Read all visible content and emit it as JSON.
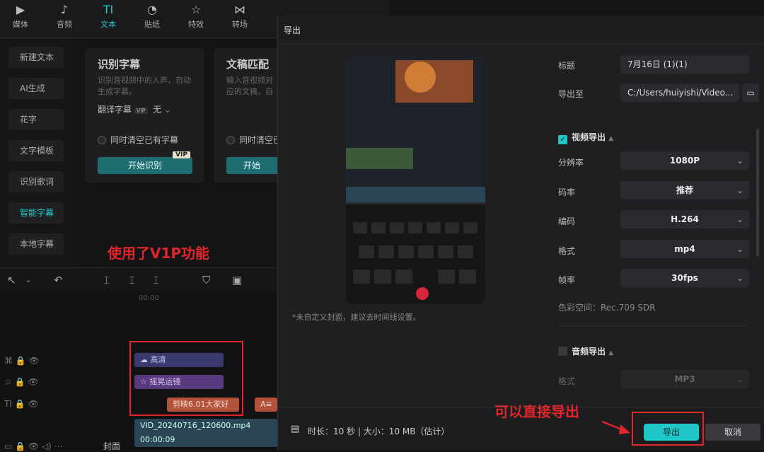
{
  "tabs": [
    {
      "label": "媒体",
      "icon": "media-icon"
    },
    {
      "label": "音频",
      "icon": "audio-icon"
    },
    {
      "label": "文本",
      "icon": "text-icon"
    },
    {
      "label": "贴纸",
      "icon": "sticker-icon"
    },
    {
      "label": "特效",
      "icon": "effects-icon"
    },
    {
      "label": "转场",
      "icon": "transition-icon"
    }
  ],
  "sidebar": {
    "items": [
      "新建文本",
      "AI生成",
      "花字",
      "文字模板",
      "识别歌词",
      "智能字幕",
      "本地字幕"
    ]
  },
  "cards": {
    "c1": {
      "title": "识别字幕",
      "desc": "识别音视频中的人声，自动生成字幕。",
      "translate_label": "翻译字幕",
      "translate_value": "无",
      "clear_label": "同时清空已有字幕",
      "btn": "开始识别",
      "vip": "VIP"
    },
    "c2": {
      "title": "文稿匹配",
      "desc": "输入音视频对应的文稿，自动匹配画面",
      "clear_label": "同时清空已有字幕",
      "btn": "开始"
    }
  },
  "annotation": {
    "vip_text": "使用了V1P功能",
    "export_text": "可以直接导出"
  },
  "timeline": {
    "ruler": "00:00",
    "clips": {
      "hd": "高清",
      "shake": "摇晃运镜",
      "text1": "剪映6.01大家好",
      "video": "VID_20240716_120600.mp4",
      "vtime": "00:00:09",
      "cover": "封面"
    }
  },
  "dialog": {
    "title": "导出",
    "cover_note": "*未自定义封面，建议去时间线设置。",
    "fields": {
      "title_label": "标题",
      "title_value": "7月16日 (1)(1)",
      "path_label": "导出至",
      "path_value": "C:/Users/huiyishi/Video..."
    },
    "video_section": "视频导出",
    "video_rows": [
      {
        "label": "分辨率",
        "value": "1080P"
      },
      {
        "label": "码率",
        "value": "推荐"
      },
      {
        "label": "编码",
        "value": "H.264"
      },
      {
        "label": "格式",
        "value": "mp4"
      },
      {
        "label": "帧率",
        "value": "30fps"
      }
    ],
    "color_space": "色彩空间：Rec.709 SDR",
    "audio_section": "音频导出",
    "audio_format_label": "格式",
    "audio_format_value": "MP3",
    "footer_info": "时长：10 秒 | 大小：10 MB（估计）",
    "export_btn": "导出",
    "cancel_btn": "取消"
  },
  "colors": {
    "accent": "#21c6c9",
    "annotation_red": "#e0262a"
  }
}
